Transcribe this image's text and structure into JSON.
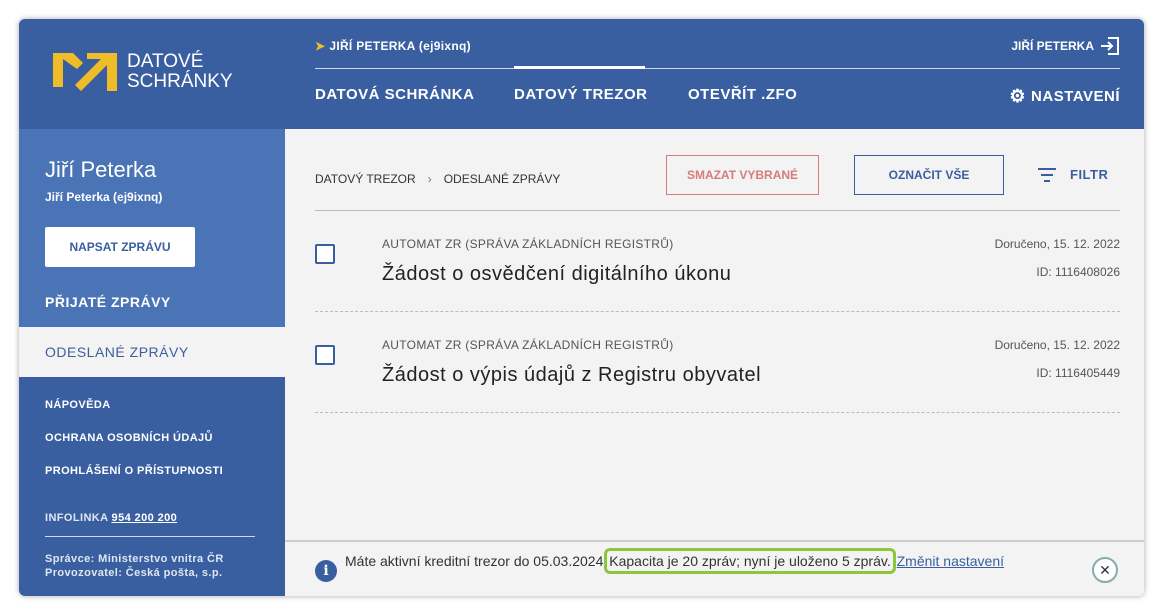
{
  "header": {
    "logo_line1": "DATOVÉ",
    "logo_line2": "SCHRÁNKY",
    "user": "JIŘÍ PETERKA (ej9ixnq)",
    "logout_user": "JIŘÍ PETERKA",
    "nav": [
      "DATOVÁ SCHRÁNKA",
      "DATOVÝ TREZOR",
      "OTEVŘÍT .ZFO"
    ],
    "settings": "NASTAVENÍ"
  },
  "sidebar": {
    "name": "Jiří Peterka",
    "sub": "Jiří Peterka (ej9ixnq)",
    "write": "NAPSAT ZPRÁVU",
    "received": "PŘIJATÉ ZPRÁVY",
    "sent": "ODESLANÉ ZPRÁVY",
    "links": [
      "NÁPOVĚDA",
      "OCHRANA OSOBNÍCH ÚDAJŮ",
      "PROHLÁŠENÍ O PŘÍSTUPNOSTI"
    ],
    "infolinka_label": "INFOLINKA",
    "infolinka_number": "954 200 200",
    "admin": "Správce: Ministerstvo vnitra ČR",
    "operator": "Provozovatel: Česká pošta, s.p."
  },
  "main": {
    "breadcrumb": [
      "DATOVÝ TREZOR",
      "ODESLANÉ ZPRÁVY"
    ],
    "delete": "SMAZAT VYBRANÉ",
    "mark_all": "OZNAČIT VŠE",
    "filter": "FILTR",
    "messages": [
      {
        "sender": "AUTOMAT ZR (SPRÁVA ZÁKLADNÍCH REGISTRŮ)",
        "subject": "Žádost o osvědčení digitálního úkonu",
        "date": "Doručeno, 15. 12. 2022",
        "id": "ID: 1116408026"
      },
      {
        "sender": "AUTOMAT ZR (SPRÁVA ZÁKLADNÍCH REGISTRŮ)",
        "subject": "Žádost o výpis údajů z Registru obyvatel",
        "date": "Doručeno, 15. 12. 2022",
        "id": "ID: 1116405449"
      }
    ]
  },
  "info": {
    "text1": "Máte aktivní kreditní trezor do 05.03.2024",
    "highlight": "Kapacita je 20 zpráv; nyní je uloženo 5 zpráv.",
    "link": "Změnit nastavení"
  },
  "colors": {
    "primary": "#3a5fa0",
    "accent": "#f0bd2a",
    "highlight": "#8cc63f"
  }
}
